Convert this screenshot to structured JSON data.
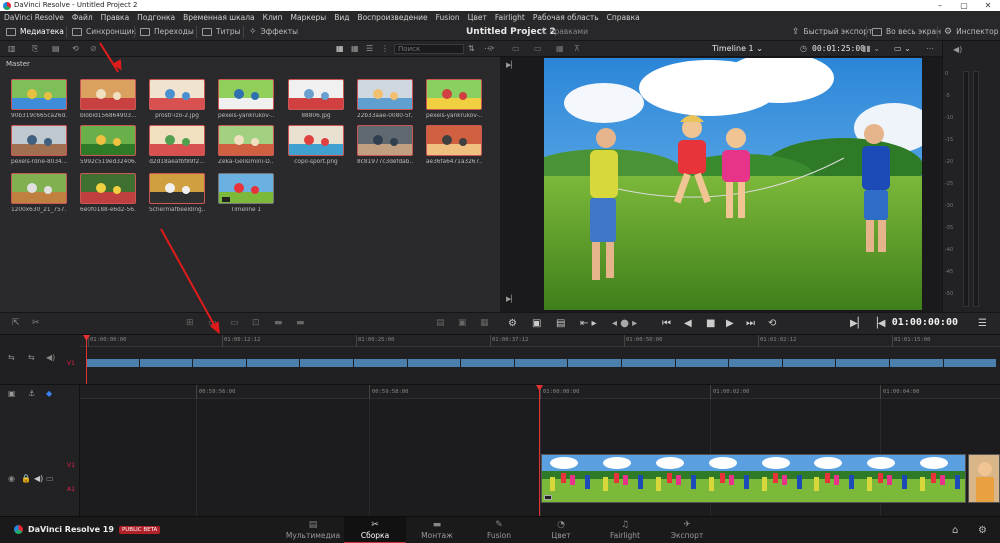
{
  "window": {
    "title": "DaVinci Resolve - Untitled Project 2"
  },
  "menu": [
    "DaVinci Resolve",
    "Файл",
    "Правка",
    "Подгонка",
    "Временная шкала",
    "Клип",
    "Маркеры",
    "Вид",
    "Воспроизведение",
    "Fusion",
    "Цвет",
    "Fairlight",
    "Рабочая область",
    "Справка"
  ],
  "toolbar": {
    "media": "Медиатека",
    "sync": "Синхронщик",
    "transitions": "Переходы",
    "titles": "Титры",
    "effects": "Эффекты",
    "project_title": "Untitled Project 2",
    "project_sub": "С правками",
    "quick_export": "Быстрый экспорт",
    "fullscreen": "Во весь экран",
    "inspector": "Инспектор"
  },
  "media_pool": {
    "search_placeholder": "Поиск",
    "bin": "Master",
    "clips": [
      "90b319c665ca26d...",
      "blobid156864903...",
      "prostr-izo-2.jpg",
      "pexels-yankrukov-...",
      "88806.jpg",
      "22b33aae-0080-5f...",
      "pexels-yankrukov-...",
      "pexels-rdne-8034...",
      "5992c519ed32406...",
      "d2d18aeafbf89f2...",
      "Zeka-Gelisimini-D...",
      "copii-sport.png",
      "8c81977c3defdab...",
      "ae36fa6471a3267...",
      "1200x630_21_757...",
      "6e0f0188-e6d2-56...",
      "Schermafbeelding...",
      "Timeline 1"
    ]
  },
  "viewer": {
    "timeline_name": "Timeline 1",
    "duration": "00:01:25:00",
    "timecode": "01:00:00:00"
  },
  "upper_ruler": [
    "01:00:00:00",
    "01:00:12:12",
    "01:00:25:00",
    "01:00:37:12",
    "01:00:50:00",
    "01:01:02:12",
    "01:01:15:00"
  ],
  "lower_ruler": [
    "00:59:56:00",
    "00:59:58:00",
    "01:00:00:00",
    "01:00:02:00",
    "01:00:04:00"
  ],
  "tracks": {
    "video": "V1",
    "audio": "A1"
  },
  "meter_ticks": [
    "0",
    "-5",
    "-10",
    "-15",
    "-20",
    "-25",
    "-30",
    "-35",
    "-40",
    "-45",
    "-50"
  ],
  "bottom": {
    "brand": "DaVinci Resolve 19",
    "badge": "PUBLIC BETA",
    "tabs": [
      "Мультимедиа",
      "Сборка",
      "Монтаж",
      "Fusion",
      "Цвет",
      "Fairlight",
      "Экспорт"
    ]
  },
  "colors": {
    "accent": "#d02f3b",
    "playhead": "#e23232",
    "clip_blue": "#4a7fae",
    "arrow": "#e01b1b"
  }
}
